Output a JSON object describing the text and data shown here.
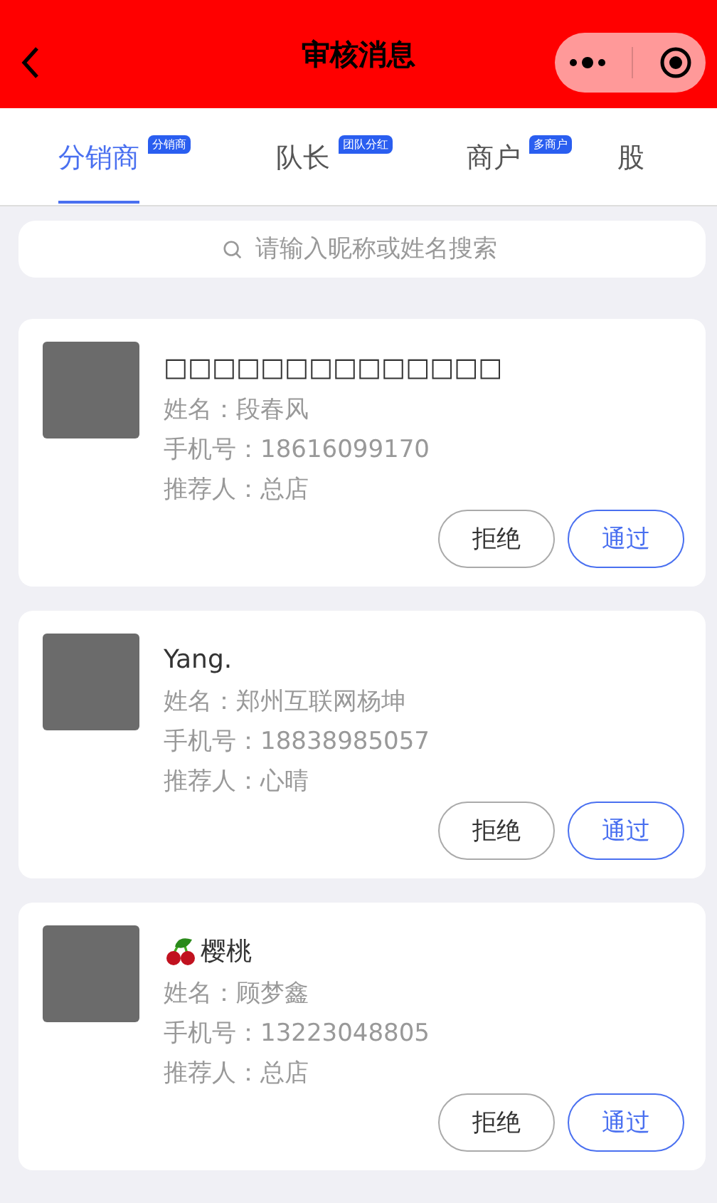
{
  "header": {
    "title": "审核消息"
  },
  "tabs": [
    {
      "label": "分销商",
      "badge": "分销商",
      "selected": true
    },
    {
      "label": "队长",
      "badge": "团队分红",
      "selected": false
    },
    {
      "label": "商户",
      "badge": "多商户",
      "selected": false
    },
    {
      "label": "股",
      "selected": false
    }
  ],
  "search": {
    "placeholder": "请输入昵称或姓名搜索"
  },
  "applicants": [
    {
      "nickname": "□□□□□□□□□□□□□□",
      "name": "姓名：段春风",
      "phone": "手机号：18616099170",
      "referrer": "推荐人：总店",
      "reject": "拒绝",
      "approve": "通过"
    },
    {
      "nickname": "Yang.",
      "name": "姓名：郑州互联网杨坤",
      "phone": "手机号：18838985057",
      "referrer": "推荐人：心晴",
      "reject": "拒绝",
      "approve": "通过"
    },
    {
      "nickname": "樱桃",
      "emoji": true,
      "name": "姓名：顾梦鑫",
      "phone": "手机号：13223048805",
      "referrer": "推荐人：总店",
      "reject": "拒绝",
      "approve": "通过"
    }
  ]
}
